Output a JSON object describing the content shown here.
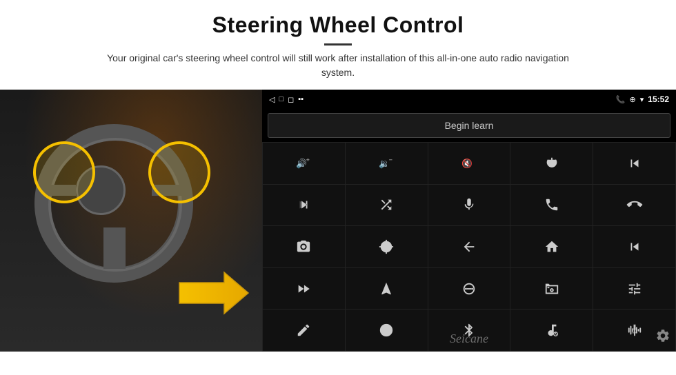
{
  "header": {
    "title": "Steering Wheel Control",
    "divider": true,
    "description": "Your original car's steering wheel control will still work after installation of this all-in-one auto radio navigation system."
  },
  "statusBar": {
    "back_icon": "◁",
    "home_icon": "□",
    "recents_icon": "◻",
    "signal_icon": "▪▪",
    "phone_icon": "📞",
    "location_icon": "⊕",
    "wifi_icon": "▾",
    "time": "15:52"
  },
  "beginLearnButton": {
    "label": "Begin learn"
  },
  "watermark": "Seicane",
  "controls": [
    {
      "id": 1,
      "icon": "vol_up",
      "symbol": "🔊+"
    },
    {
      "id": 2,
      "icon": "vol_down",
      "symbol": "🔊−"
    },
    {
      "id": 3,
      "icon": "mute",
      "symbol": "🔇"
    },
    {
      "id": 4,
      "icon": "power",
      "symbol": "⏻"
    },
    {
      "id": 5,
      "icon": "prev_track",
      "symbol": "⏮"
    },
    {
      "id": 6,
      "icon": "next",
      "symbol": "⏭"
    },
    {
      "id": 7,
      "icon": "shuffle",
      "symbol": "⇌⏭"
    },
    {
      "id": 8,
      "icon": "mic",
      "symbol": "🎤"
    },
    {
      "id": 9,
      "icon": "phone",
      "symbol": "📞"
    },
    {
      "id": 10,
      "icon": "end_call",
      "symbol": "📵"
    },
    {
      "id": 11,
      "icon": "camera",
      "symbol": "📷"
    },
    {
      "id": 12,
      "icon": "360",
      "symbol": "360"
    },
    {
      "id": 13,
      "icon": "back",
      "symbol": "↩"
    },
    {
      "id": 14,
      "icon": "home",
      "symbol": "⌂"
    },
    {
      "id": 15,
      "icon": "skip_back",
      "symbol": "⏮⏮"
    },
    {
      "id": 16,
      "icon": "fast_forward",
      "symbol": "⏭⏭"
    },
    {
      "id": 17,
      "icon": "navigate",
      "symbol": "➤"
    },
    {
      "id": 18,
      "icon": "equalizer",
      "symbol": "⇌"
    },
    {
      "id": 19,
      "icon": "radio",
      "symbol": "📻"
    },
    {
      "id": 20,
      "icon": "sliders",
      "symbol": "⊹"
    },
    {
      "id": 21,
      "icon": "pen",
      "symbol": "✎"
    },
    {
      "id": 22,
      "icon": "circle_dot",
      "symbol": "◎"
    },
    {
      "id": 23,
      "icon": "bluetooth",
      "symbol": "⊕"
    },
    {
      "id": 24,
      "icon": "music_settings",
      "symbol": "🎵"
    },
    {
      "id": 25,
      "icon": "waveform",
      "symbol": "≋"
    }
  ]
}
